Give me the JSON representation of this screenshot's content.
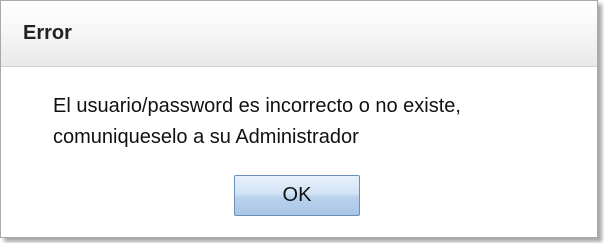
{
  "dialog": {
    "title": "Error",
    "message_line1": "El usuario/password es incorrecto o no existe,",
    "message_line2": "comuniqueselo a su Administrador",
    "ok_label": "OK"
  }
}
